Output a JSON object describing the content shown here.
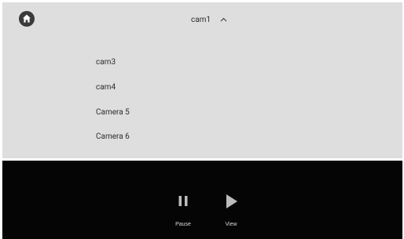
{
  "header": {
    "home_icon": "home-icon",
    "camera_select": {
      "selected": "cam1",
      "expanded": true,
      "icon": "chevron-up-icon"
    }
  },
  "dropdown": {
    "items": [
      {
        "label": "cam3"
      },
      {
        "label": "cam4"
      },
      {
        "label": "Camera 5"
      },
      {
        "label": "Camera 6"
      }
    ]
  },
  "controls": {
    "pause": {
      "label": "Pause",
      "icon": "pause-icon"
    },
    "view": {
      "label": "View",
      "icon": "play-icon"
    }
  },
  "colors": {
    "panel_background": "#dedede",
    "bar_background": "#050505",
    "icon_light": "#bcbcbc",
    "home_icon": "#3a3a3a"
  }
}
